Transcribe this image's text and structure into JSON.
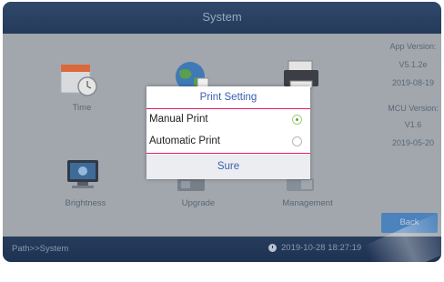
{
  "header": {
    "title": "System"
  },
  "tiles": [
    {
      "label": "Time",
      "icon": "calendar-clock-icon"
    },
    {
      "label": "",
      "icon": "globe-icon"
    },
    {
      "label": "",
      "icon": "printer-icon"
    },
    {
      "label": "Brightness",
      "icon": "monitor-icon"
    },
    {
      "label": "Upgrade",
      "icon": "upgrade-icon"
    },
    {
      "label": "Management",
      "icon": "management-icon"
    }
  ],
  "app_info": {
    "app_version_label": "App Version:",
    "app_version": "V5.1.2e",
    "app_date": "2019-08-19",
    "mcu_version_label": "MCU Version:",
    "mcu_version": "V1.6",
    "mcu_date": "2019-05-20"
  },
  "back_button": "Back",
  "status": {
    "path": "Path>>System",
    "datetime": "2019-10-28 18:27:19"
  },
  "dialog": {
    "title": "Print Setting",
    "options": [
      {
        "label": "Manual Print",
        "selected": true
      },
      {
        "label": "Automatic Print",
        "selected": false
      }
    ],
    "confirm": "Sure"
  },
  "colors": {
    "accent_pink": "#e8196b",
    "dialog_text_blue": "#3a5fae",
    "radio_green": "#5aaa33",
    "titlebar": "#2f4a6e",
    "back_button": "#4f89c6"
  }
}
